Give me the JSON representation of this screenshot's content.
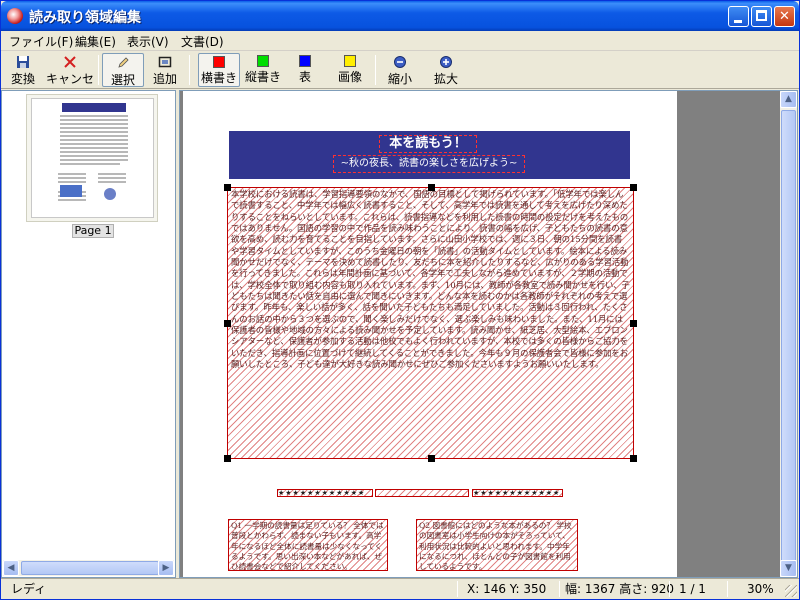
{
  "window": {
    "title": "読み取り領域編集"
  },
  "menu": [
    "ファイル(F)",
    "編集(E)",
    "表示(V)",
    "文書(D)"
  ],
  "toolbar": {
    "convert": "変換",
    "cancel": "キャンセル",
    "select": "選択",
    "add": "追加",
    "horizontal": "横書き",
    "vertical": "縦書き",
    "table": "表",
    "image": "画像",
    "zoom_out": "縮小",
    "zoom_in": "拡大"
  },
  "colors": {
    "horizontal": "#ff0000",
    "vertical": "#00dd00",
    "table": "#0000ff",
    "image": "#ffee00",
    "banner": "#31358f",
    "region": "#c00000"
  },
  "thumbnail": {
    "caption": "Page 1"
  },
  "document": {
    "title": "本を読もう！",
    "subtitle": "~秋の夜長、読書の楽しさを広げよう~",
    "body": "本学校における読書は、学習指導要領のなかで、国語の目標として掲げられています。「低学年では楽しんで読書すること、中学年では幅広く読書すること、そして、高学年では読書を通して考えを広げたり深めたりすることをねらいとしています。これらは、読書指導などを利用した読書の時間の設定だけを考えたものではありません。国語の学習の中で作品を読み味わうことにより、読書の幅を広げ、子どもたちの読書の意欲を高め、読む力を育てることを目指しています。さらに山田小学校では、週に３日、朝の15分間を読書や学習タイムとしていますが、このうち金曜日の朝を「読書」の活動タイムとしています。絵本による読み聞かせだけでなく、テーマを決めて読書したり、友だちに本を紹介したりするなど、広がりのある学習活動を行ってきました。これらは年間計画に基づいて、各学年で工夫しながら進めていますが、２学期の活動では、学校全体で取り組む内容も取り入れています。まず、10月には、教師が各教室で読み聞かせを行い、子どもたちは聞きたい話を自由に選んで聞きにいきます。どんな本を読むのかは各教師がそれぞれの考えで選びます。昨年も、楽しい話が多く、話を聞いた子どもたちも満足していました。活動は３回行われ、たくさんのお話の中から３つを選ぶので、聞く楽しみだけでなく、選ぶ楽しみも味わいました。また、11月には保護者の皆様や地域の方々による読み聞かせを予定しています。読み聞かせ、紙芝居、大型絵本、エプロンシアターなど、保護者が参加する活動は他校でもよく行われていますが、本校では多くの皆様からご協力をいただき、指導計画に位置づけて継続してくることができました。今年も９月の保護者会で皆様に参加をお願いしたところ、子ども達が大好きな読み聞かせにぜひご参加くださいますようお願いいたします。",
    "box_left": "Q1 一学期の読書量は足りている？ 全体では普段とかわらず、読まない子もいます。高学年になるほど全体に読書量は少なくなってくるようです。思い出深い本などがあれば、ぜひ読書会などで紹介してください。",
    "box_right": "Q2 図書館にはどのような本があるの？ 学校の図書室は小学生向けの本がそろっていて、利用状況は比較的よいと思われます。中学年になるにつれ、ほとんどの子が図書館を利用しているようです。",
    "star_char": "★"
  },
  "status": {
    "state": "レディ",
    "coords": "X: 146  Y: 350",
    "size": "幅: 1367  高さ: 920",
    "page": "1 / 1",
    "zoom": "30%"
  }
}
